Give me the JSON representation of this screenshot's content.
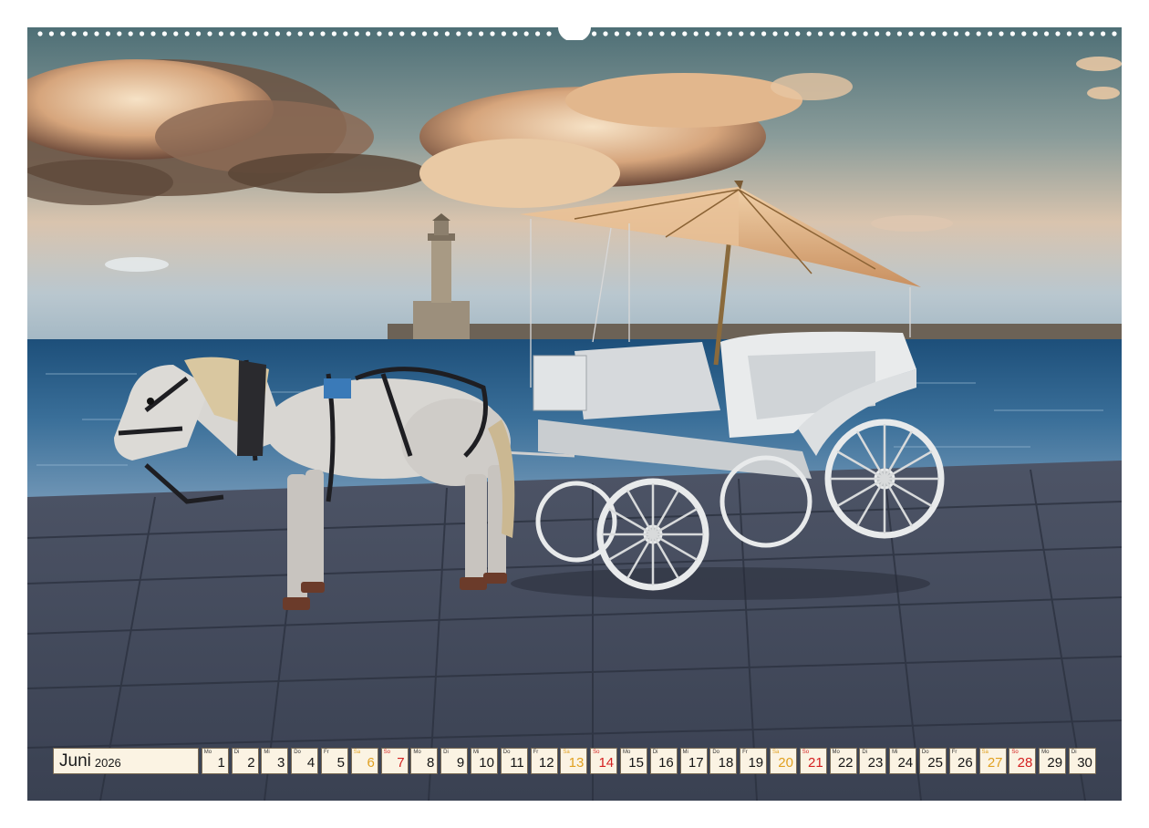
{
  "calendar": {
    "month": "Juni",
    "year": "2026",
    "colors": {
      "cell_bg": "#fbf3e3",
      "saturday": "#e0a020",
      "sunday": "#d42020",
      "text": "#151515"
    },
    "days": [
      {
        "wd": "Mo",
        "d": "1"
      },
      {
        "wd": "Di",
        "d": "2"
      },
      {
        "wd": "Mi",
        "d": "3"
      },
      {
        "wd": "Do",
        "d": "4"
      },
      {
        "wd": "Fr",
        "d": "5"
      },
      {
        "wd": "Sa",
        "d": "6"
      },
      {
        "wd": "So",
        "d": "7"
      },
      {
        "wd": "Mo",
        "d": "8"
      },
      {
        "wd": "Di",
        "d": "9"
      },
      {
        "wd": "Mi",
        "d": "10"
      },
      {
        "wd": "Do",
        "d": "11"
      },
      {
        "wd": "Fr",
        "d": "12"
      },
      {
        "wd": "Sa",
        "d": "13"
      },
      {
        "wd": "So",
        "d": "14"
      },
      {
        "wd": "Mo",
        "d": "15"
      },
      {
        "wd": "Di",
        "d": "16"
      },
      {
        "wd": "Mi",
        "d": "17"
      },
      {
        "wd": "Do",
        "d": "18"
      },
      {
        "wd": "Fr",
        "d": "19"
      },
      {
        "wd": "Sa",
        "d": "20"
      },
      {
        "wd": "So",
        "d": "21"
      },
      {
        "wd": "Mo",
        "d": "22"
      },
      {
        "wd": "Di",
        "d": "23"
      },
      {
        "wd": "Mi",
        "d": "24"
      },
      {
        "wd": "Do",
        "d": "25"
      },
      {
        "wd": "Fr",
        "d": "26"
      },
      {
        "wd": "Sa",
        "d": "27"
      },
      {
        "wd": "So",
        "d": "28"
      },
      {
        "wd": "Mo",
        "d": "29"
      },
      {
        "wd": "Di",
        "d": "30"
      }
    ]
  }
}
